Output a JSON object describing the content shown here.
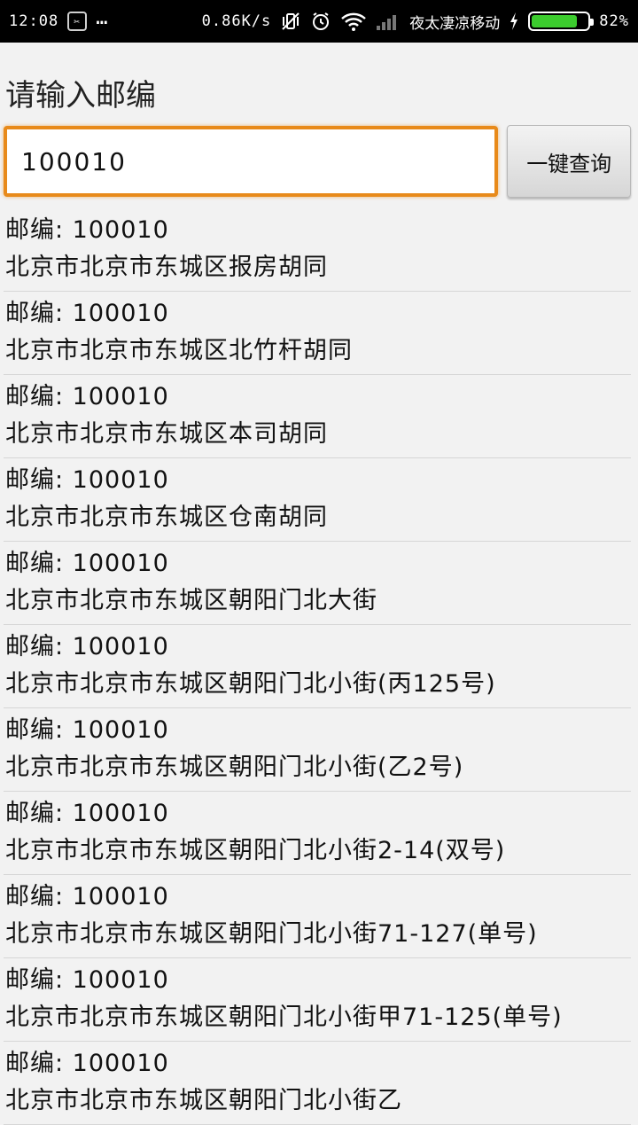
{
  "status_bar": {
    "time": "12:08",
    "speed": "0.86K/s",
    "carrier": "夜太凄凉移动",
    "battery": "82%",
    "battery_level": 0.82
  },
  "prompt": "请输入邮编",
  "search": {
    "value": "100010",
    "button_label": "一键查询"
  },
  "results": [
    {
      "zip": "邮编: 100010",
      "address": "北京市北京市东城区报房胡同"
    },
    {
      "zip": "邮编: 100010",
      "address": "北京市北京市东城区北竹杆胡同"
    },
    {
      "zip": "邮编: 100010",
      "address": "北京市北京市东城区本司胡同"
    },
    {
      "zip": "邮编: 100010",
      "address": "北京市北京市东城区仓南胡同"
    },
    {
      "zip": "邮编: 100010",
      "address": "北京市北京市东城区朝阳门北大街"
    },
    {
      "zip": "邮编: 100010",
      "address": "北京市北京市东城区朝阳门北小街(丙125号)"
    },
    {
      "zip": "邮编: 100010",
      "address": "北京市北京市东城区朝阳门北小街(乙2号)"
    },
    {
      "zip": "邮编: 100010",
      "address": "北京市北京市东城区朝阳门北小街2-14(双号)"
    },
    {
      "zip": "邮编: 100010",
      "address": "北京市北京市东城区朝阳门北小街71-127(单号)"
    },
    {
      "zip": "邮编: 100010",
      "address": "北京市北京市东城区朝阳门北小街甲71-125(单号)"
    },
    {
      "zip": "邮编: 100010",
      "address": "北京市北京市东城区朝阳门北小街乙"
    }
  ]
}
